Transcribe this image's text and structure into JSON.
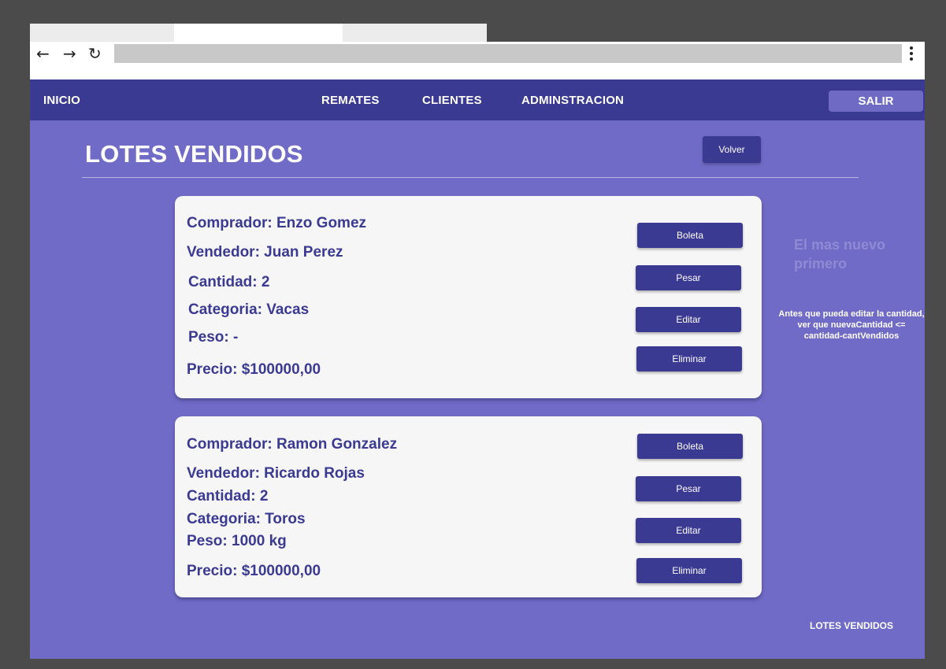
{
  "browser": {
    "back_icon": "←",
    "forward_icon": "→",
    "reload_icon": "↻"
  },
  "nav": {
    "inicio": "INICIO",
    "remates": "REMATES",
    "clientes": "CLIENTES",
    "administracion": "ADMINSTRACION",
    "salir": "SALIR"
  },
  "page": {
    "title": "LOTES VENDIDOS",
    "volver": "Volver"
  },
  "lots": [
    {
      "comprador": "Comprador: Enzo Gomez",
      "vendedor": "Vendedor: Juan Perez",
      "cantidad": "Cantidad: 2",
      "categoria": "Categoria: Vacas",
      "peso": "Peso: -",
      "precio": "Precio: $100000,00"
    },
    {
      "comprador": "Comprador: Ramon Gonzalez",
      "vendedor": "Vendedor: Ricardo Rojas",
      "cantidad": "Cantidad: 2",
      "categoria": "Categoria: Toros",
      "peso": "Peso: 1000 kg",
      "precio": "Precio: $100000,00"
    }
  ],
  "actions": {
    "boleta": "Boleta",
    "pesar": "Pesar",
    "editar": "Editar",
    "eliminar": "Eliminar"
  },
  "notes": {
    "sort": "El mas nuevo primero",
    "edit": "Antes que pueda editar la cantidad, ver que nuevaCantidad <= cantidad-cantVendidos"
  },
  "footer": {
    "label": "LOTES VENDIDOS"
  },
  "colors": {
    "nav_bg": "#3b3a92",
    "page_bg": "#706bc7",
    "card_bg": "#f6f6f6",
    "accent_text": "#3b3a92"
  }
}
